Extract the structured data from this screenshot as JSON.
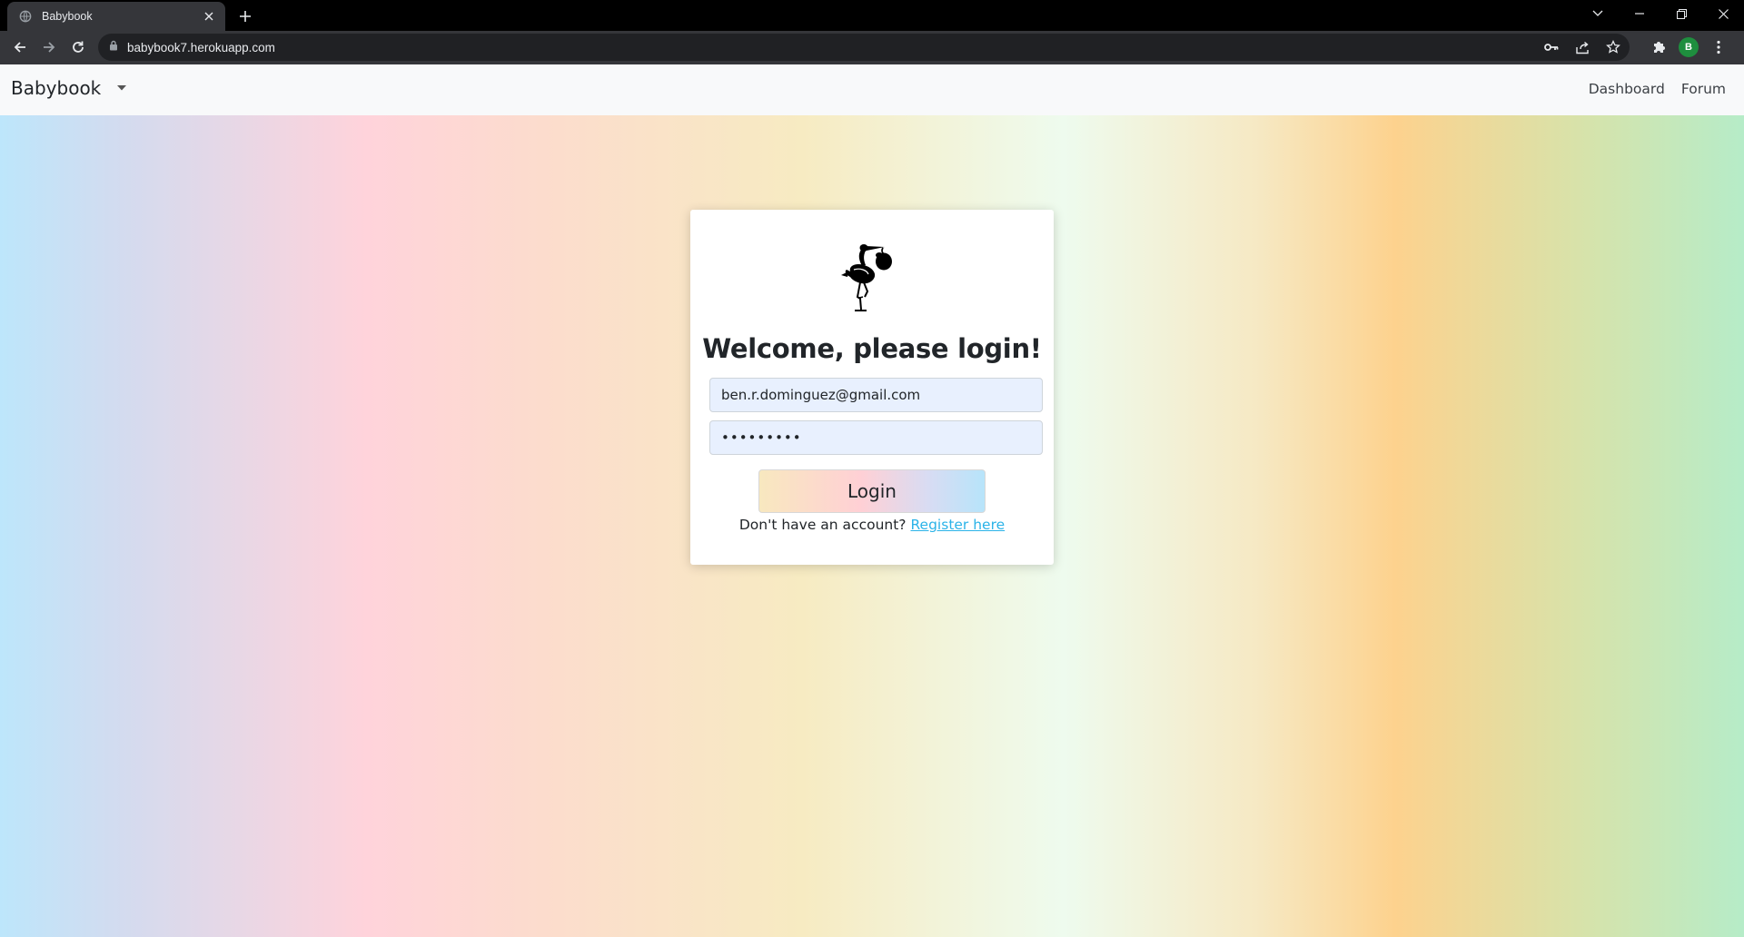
{
  "browser": {
    "tab_title": "Babybook",
    "url": "babybook7.herokuapp.com",
    "profile_initial": "B",
    "icons": [
      "globe-icon",
      "close-icon",
      "plus-icon",
      "back-icon",
      "forward-icon",
      "reload-icon",
      "lock-icon",
      "key-icon",
      "share-icon",
      "star-icon",
      "puzzle-icon",
      "kebab-menu-icon",
      "minimize-icon",
      "restore-icon",
      "tab-search-icon"
    ]
  },
  "navbar": {
    "brand": "Babybook",
    "links": [
      "Dashboard",
      "Forum"
    ]
  },
  "login": {
    "heading": "Welcome, please login!",
    "email_value": "ben.r.dominguez@gmail.com",
    "password_value": "•••••••••",
    "button_label": "Login",
    "register_prompt": "Don't have an account?",
    "register_link": "Register here",
    "logo": "stork-icon"
  },
  "colors": {
    "link": "#2bb3e8",
    "autofill": "#e8f0fe",
    "navbar_bg": "#f8f9fa",
    "chrome_dark": "#35363a"
  }
}
